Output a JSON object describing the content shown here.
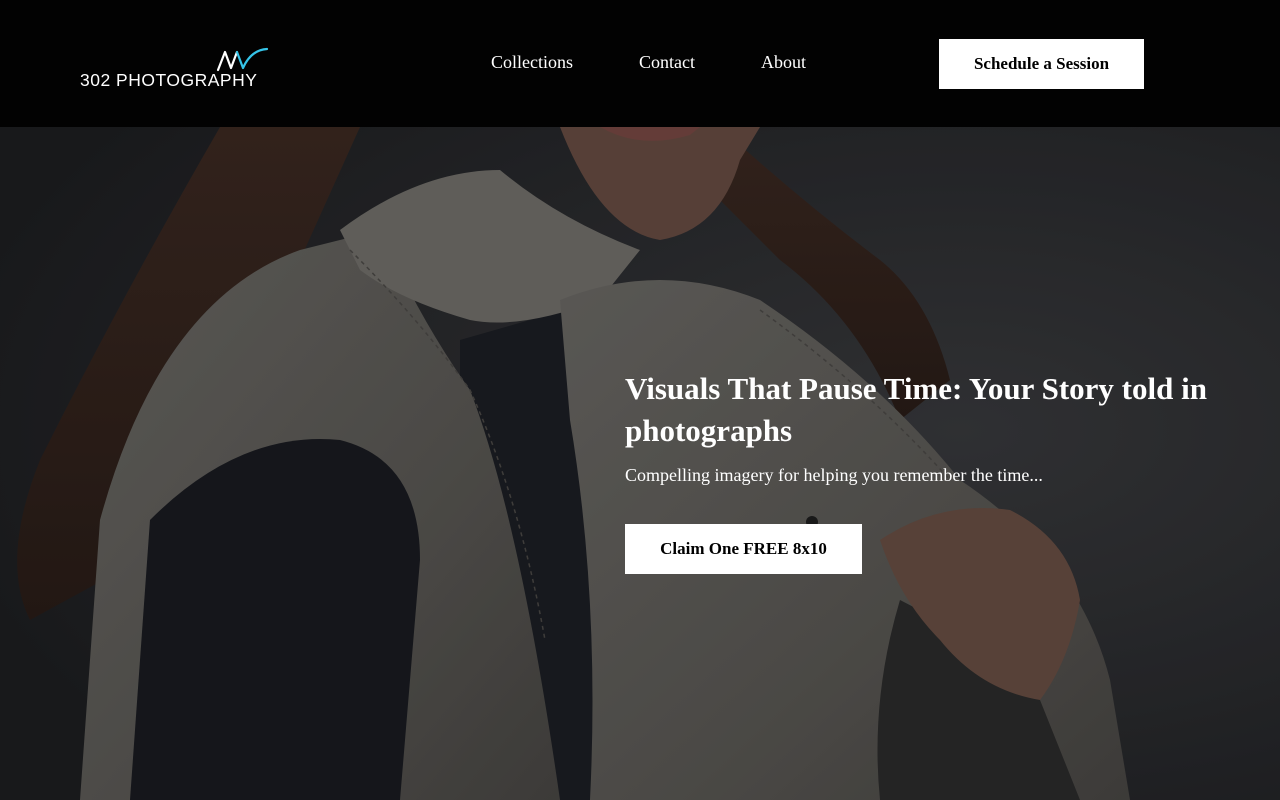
{
  "brand": {
    "name": "302 PHOTOGRAPHY",
    "accent_color": "#35c4e8"
  },
  "nav": {
    "items": [
      {
        "label": "Collections"
      },
      {
        "label": "Contact"
      },
      {
        "label": "About"
      }
    ],
    "cta_label": "Schedule a Session"
  },
  "hero": {
    "title": "Visuals That Pause Time: Your Story told in photographs",
    "subtitle": "Compelling imagery for helping you remember the time...",
    "cta_label": "Claim One FREE 8x10"
  }
}
